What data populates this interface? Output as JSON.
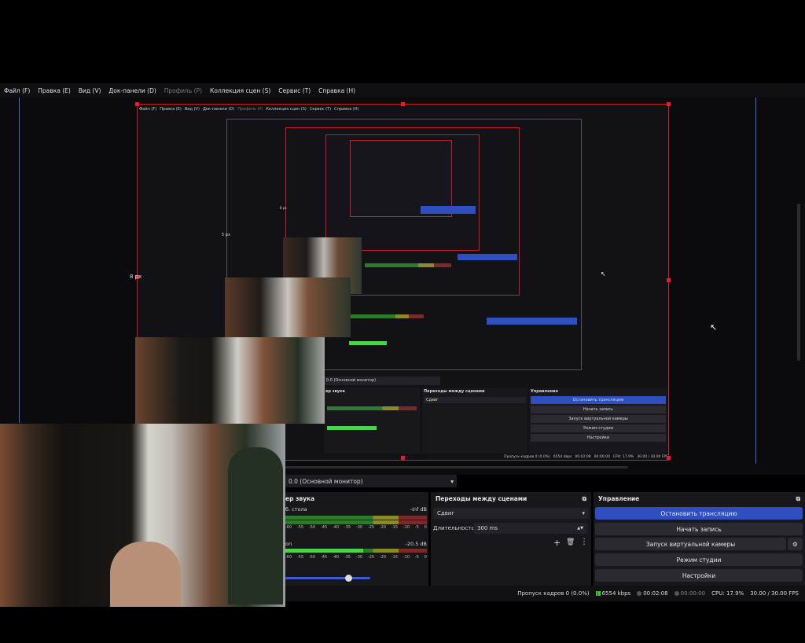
{
  "menu": {
    "items": [
      {
        "label": "Файл (F)",
        "enabled": true
      },
      {
        "label": "Правка (E)",
        "enabled": true
      },
      {
        "label": "Вид (V)",
        "enabled": true
      },
      {
        "label": "Док-панели (D)",
        "enabled": true
      },
      {
        "label": "Профиль (P)",
        "enabled": false
      },
      {
        "label": "Коллекция сцен (S)",
        "enabled": true
      },
      {
        "label": "Сервис (T)",
        "enabled": true
      },
      {
        "label": "Справка (H)",
        "enabled": true
      }
    ]
  },
  "preview": {
    "px_label_1": "8 px",
    "px_label_2": "5 px",
    "px_label_3": "8 px"
  },
  "monitor_select": {
    "value": "0.0 (Основной монитор)"
  },
  "audio_mixer": {
    "title": "ер звука",
    "channels": [
      {
        "name": "б. стола",
        "db": "-inf dB",
        "level": 0
      },
      {
        "name": "оп",
        "db": "-20.5 dB",
        "level": 0.55
      }
    ],
    "scale": [
      "-60",
      "-55",
      "-50",
      "-45",
      "-40",
      "-35",
      "-30",
      "-25",
      "-20",
      "-15",
      "-10",
      "-5",
      "0"
    ]
  },
  "transitions": {
    "title": "Переходы между сценами",
    "transition_value": "Сдвиг",
    "duration_label": "Длительность",
    "duration_value": "300 ms"
  },
  "controls": {
    "title": "Управление",
    "stop_stream": "Остановить трансляцию",
    "start_record": "Начать запись",
    "virtual_cam": "Запуск виртуальной камеры",
    "studio_mode": "Режим студии",
    "settings": "Настройки"
  },
  "status": {
    "dropped": "Пропуск кадров 0 (0.0%)",
    "bitrate": "6554 kbps",
    "stream_time": "00:02:08",
    "record_time": "00:00:00",
    "cpu": "CPU: 17.9%",
    "fps": "30.00 / 30.00 FPS"
  },
  "colors": {
    "accent": "#2f4fc0",
    "selection_red": "#c81e28",
    "guide_blue": "#3c6ed8"
  }
}
